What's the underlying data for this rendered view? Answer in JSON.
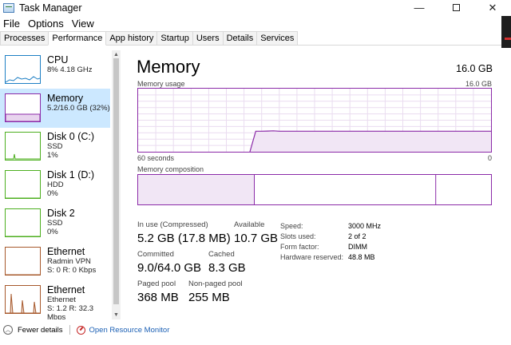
{
  "window": {
    "title": "Task Manager",
    "minimize": "—",
    "close": "✕"
  },
  "menu": [
    "File",
    "Options",
    "View"
  ],
  "tabs": [
    "Processes",
    "Performance",
    "App history",
    "Startup",
    "Users",
    "Details",
    "Services"
  ],
  "active_tab": "Performance",
  "sidebar": [
    {
      "name": "CPU",
      "sub1": "8%  4.18 GHz",
      "sub2": "",
      "color": "#1d7fc4"
    },
    {
      "name": "Memory",
      "sub1": "5.2/16.0 GB (32%)",
      "sub2": "",
      "color": "#8b2aa8",
      "selected": true
    },
    {
      "name": "Disk 0 (C:)",
      "sub1": "SSD",
      "sub2": "1%",
      "color": "#4caf1e"
    },
    {
      "name": "Disk 1 (D:)",
      "sub1": "HDD",
      "sub2": "0%",
      "color": "#4caf1e"
    },
    {
      "name": "Disk 2",
      "sub1": "SSD",
      "sub2": "0%",
      "color": "#4caf1e"
    },
    {
      "name": "Ethernet",
      "sub1": "Radmin VPN",
      "sub2": "S: 0  R: 0 Kbps",
      "color": "#a7582b"
    },
    {
      "name": "Ethernet",
      "sub1": "Ethernet",
      "sub2": "S: 1.2  R: 32.3 Mbps",
      "color": "#a7582b"
    }
  ],
  "main": {
    "title": "Memory",
    "total": "16.0 GB",
    "usage_label": "Memory usage",
    "usage_max": "16.0 GB",
    "time_left": "60 seconds",
    "time_right": "0",
    "composition_label": "Memory composition",
    "in_use_label": "In use (Compressed)",
    "in_use_value": "5.2 GB (17.8 MB)",
    "available_label": "Available",
    "available_value": "10.7 GB",
    "committed_label": "Committed",
    "committed_value": "9.0/64.0 GB",
    "cached_label": "Cached",
    "cached_value": "8.3 GB",
    "paged_label": "Paged pool",
    "paged_value": "368 MB",
    "nonpaged_label": "Non-paged pool",
    "nonpaged_value": "255 MB",
    "details": [
      {
        "k": "Speed:",
        "v": "3000 MHz"
      },
      {
        "k": "Slots used:",
        "v": "2 of 2"
      },
      {
        "k": "Form factor:",
        "v": "DIMM"
      },
      {
        "k": "Hardware reserved:",
        "v": "48.8 MB"
      }
    ]
  },
  "usage_series": {
    "max_gb": 16,
    "in_use_gb": [
      0,
      0,
      0,
      0,
      0,
      0,
      0,
      0,
      0,
      0,
      0,
      0,
      0,
      0,
      0,
      0,
      0,
      0,
      0,
      0,
      5.2,
      5.2,
      5.25,
      5.3,
      5.2,
      5.2,
      5.2,
      5.2,
      5.2,
      5.2,
      5.2,
      5.2,
      5.2,
      5.2,
      5.2,
      5.2,
      5.2,
      5.2,
      5.2,
      5.2,
      5.2,
      5.2,
      5.2,
      5.2,
      5.2,
      5.2,
      5.2,
      5.2,
      5.2,
      5.2,
      5.2,
      5.2,
      5.2,
      5.2,
      5.2,
      5.2,
      5.2,
      5.2,
      5.2,
      5.2,
      5.2
    ],
    "start_index": 19
  },
  "composition": {
    "in_use_gb": 5.2,
    "modified_gb": 0.05,
    "standby_gb": 8.2,
    "free_gb": 2.5
  },
  "footer": {
    "fewer": "Fewer details",
    "monitor": "Open Resource Monitor"
  }
}
